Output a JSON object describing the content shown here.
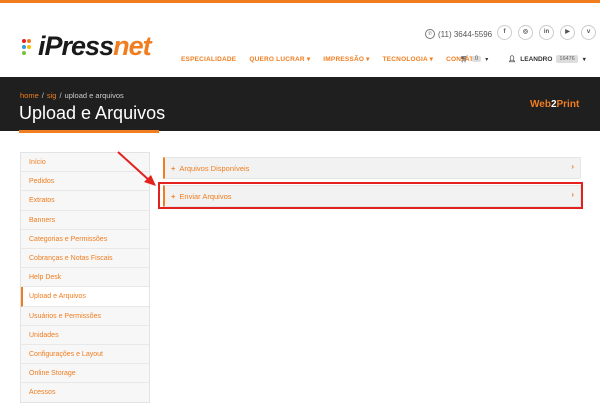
{
  "header": {
    "logo": {
      "prefix": "i",
      "press": "Press",
      "net": "net"
    },
    "phone": "(11) 3644-5596",
    "social_icons": [
      "facebook-icon",
      "instagram-icon",
      "linkedin-icon",
      "youtube-icon",
      "vimeo-icon"
    ],
    "nav": [
      {
        "label": "ESPECIALIDADE"
      },
      {
        "label": "QUERO LUCRAR ▾"
      },
      {
        "label": "IMPRESSÃO ▾"
      },
      {
        "label": "TECNOLOGIA ▾"
      },
      {
        "label": "CONTATO"
      }
    ],
    "cart_count": "0",
    "user_name": "LEANDRO",
    "user_badge": "16476"
  },
  "breadcrumb": {
    "home": "home",
    "sig": "sig",
    "current": "upload e arquivos"
  },
  "page_title": "Upload e Arquivos",
  "brand": {
    "part1": "Web",
    "part2": "2",
    "part3": "Print"
  },
  "sidebar": {
    "items": [
      {
        "label": "Início"
      },
      {
        "label": "Pedidos"
      },
      {
        "label": "Extratos"
      },
      {
        "label": "Banners"
      },
      {
        "label": "Categorias e Permissões"
      },
      {
        "label": "Cobranças e Notas Fiscais"
      },
      {
        "label": "Help Desk"
      },
      {
        "label": "Upload e Arquivos"
      },
      {
        "label": "Usuários e Permissões"
      },
      {
        "label": "Unidades"
      },
      {
        "label": "Configurações e Layout"
      },
      {
        "label": "Online Storage"
      },
      {
        "label": "Acessos"
      }
    ],
    "active_index": 7
  },
  "panels": [
    {
      "label": "Arquivos Disponíveis"
    },
    {
      "label": "Enviar Arquivos"
    }
  ],
  "colors": {
    "accent": "#f07d1f",
    "banner": "#1f1f1f",
    "highlight": "#e3211f"
  }
}
